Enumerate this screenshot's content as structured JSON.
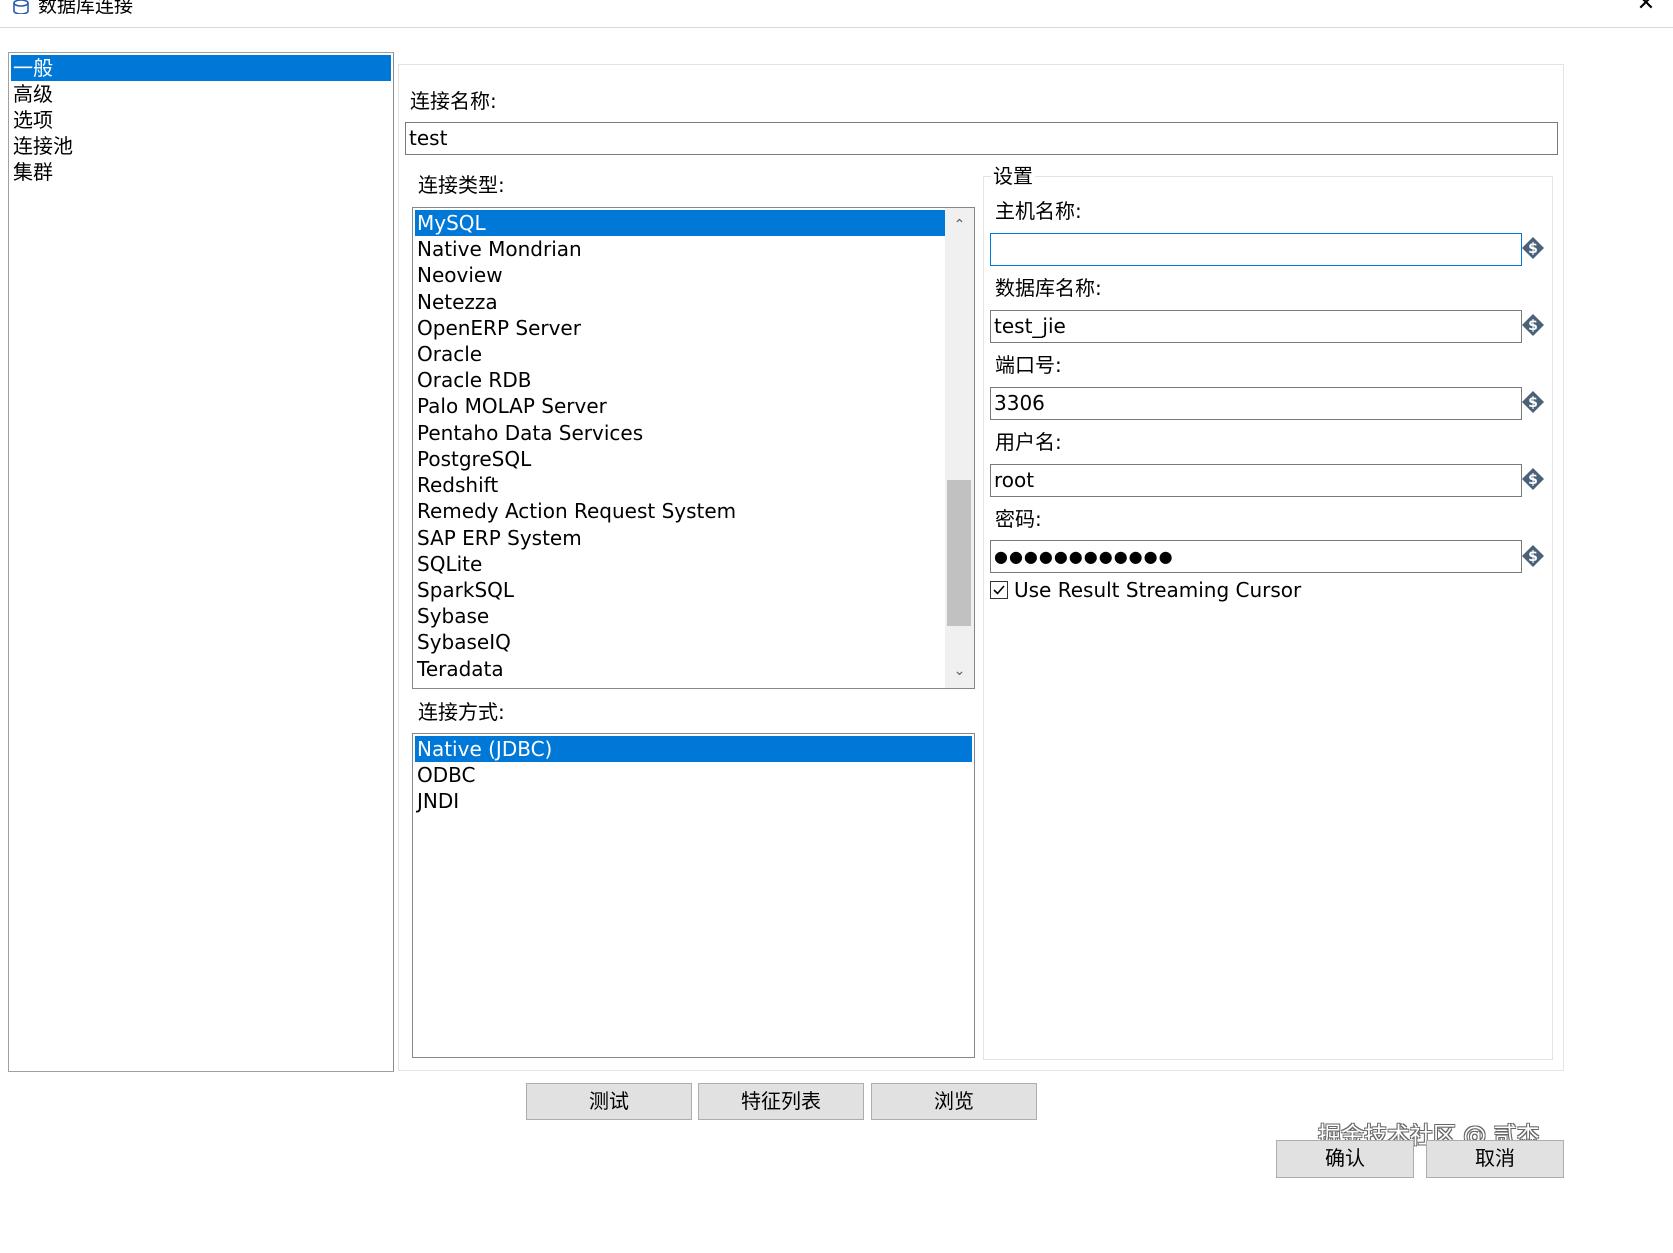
{
  "window": {
    "title": "数据库连接",
    "close_symbol": "✕"
  },
  "sidebar": {
    "items": [
      {
        "label": "一般",
        "selected": true
      },
      {
        "label": "高级",
        "selected": false
      },
      {
        "label": "选项",
        "selected": false
      },
      {
        "label": "连接池",
        "selected": false
      },
      {
        "label": "集群",
        "selected": false
      }
    ]
  },
  "general": {
    "connection_name_label": "连接名称:",
    "connection_name_value": "test",
    "connection_type_label": "连接类型:",
    "connection_types": [
      {
        "label": "MySQL",
        "selected": true
      },
      {
        "label": "Native Mondrian",
        "selected": false
      },
      {
        "label": "Neoview",
        "selected": false
      },
      {
        "label": "Netezza",
        "selected": false
      },
      {
        "label": "OpenERP Server",
        "selected": false
      },
      {
        "label": "Oracle",
        "selected": false
      },
      {
        "label": "Oracle RDB",
        "selected": false
      },
      {
        "label": "Palo MOLAP Server",
        "selected": false
      },
      {
        "label": "Pentaho Data Services",
        "selected": false
      },
      {
        "label": "PostgreSQL",
        "selected": false
      },
      {
        "label": "Redshift",
        "selected": false
      },
      {
        "label": "Remedy Action Request System",
        "selected": false
      },
      {
        "label": "SAP ERP System",
        "selected": false
      },
      {
        "label": "SQLite",
        "selected": false
      },
      {
        "label": "SparkSQL",
        "selected": false
      },
      {
        "label": "Sybase",
        "selected": false
      },
      {
        "label": "SybaseIQ",
        "selected": false
      },
      {
        "label": "Teradata",
        "selected": false
      }
    ],
    "scroll_up_symbol": "⌃",
    "scroll_down_symbol": "⌄",
    "access_label": "连接方式:",
    "access_types": [
      {
        "label": "Native (JDBC)",
        "selected": true
      },
      {
        "label": "ODBC",
        "selected": false
      },
      {
        "label": "JNDI",
        "selected": false
      }
    ]
  },
  "settings": {
    "group_label": "设置",
    "host_label": "主机名称:",
    "host_value": "",
    "database_label": "数据库名称:",
    "database_value": "test_jie",
    "port_label": "端口号:",
    "port_value": "3306",
    "user_label": "用户名:",
    "user_value": "root",
    "password_label": "密码:",
    "password_value": "●●●●●●●●●●●●",
    "streaming_cursor_label": "Use Result Streaming Cursor",
    "streaming_cursor_checked": true,
    "variable_icon": "variable-dollar-icon"
  },
  "actions": {
    "test_label": "测试",
    "features_label": "特征列表",
    "explore_label": "浏览",
    "ok_label": "确认",
    "cancel_label": "取消"
  },
  "watermark": "掘金技术社区 @ 贰杰",
  "colors": {
    "selection": "#0078d7",
    "button_face": "#e1e1e1",
    "variable_icon": "#4a6178"
  }
}
